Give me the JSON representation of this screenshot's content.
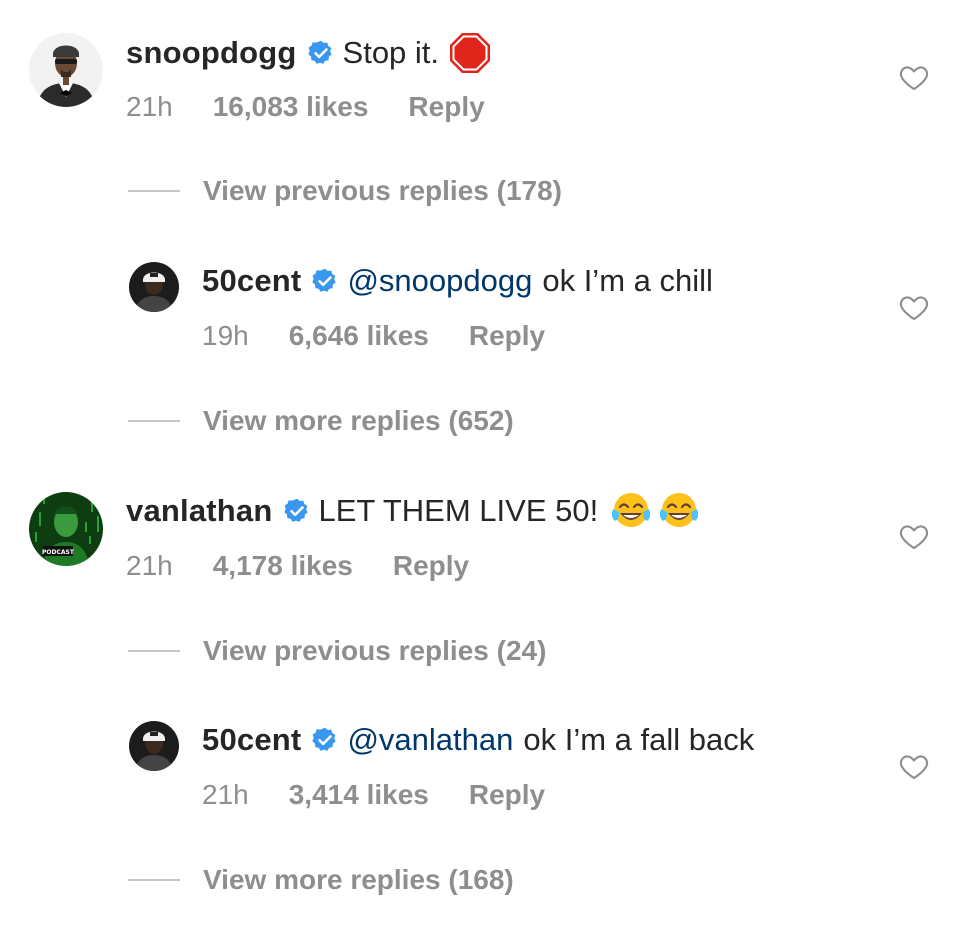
{
  "comments": [
    {
      "username": "snoopdogg",
      "text": "Stop it.",
      "emoji": "stop-sign",
      "time": "21h",
      "likes": "16,083 likes",
      "reply": "Reply"
    },
    {
      "username": "50cent",
      "mention": "@snoopdogg",
      "text": "ok I’m a chill",
      "time": "19h",
      "likes": "6,646 likes",
      "reply": "Reply"
    },
    {
      "username": "vanlathan",
      "text": "LET THEM LIVE 50!",
      "emoji": "face-with-tears-of-joy",
      "time": "21h",
      "likes": "4,178 likes",
      "reply": "Reply"
    },
    {
      "username": "50cent",
      "mention": "@vanlathan",
      "text": "ok I’m a fall back",
      "time": "21h",
      "likes": "3,414 likes",
      "reply": "Reply"
    }
  ],
  "view_links": [
    "View previous replies (178)",
    "View more replies (652)",
    "View previous replies (24)",
    "View more replies (168)"
  ],
  "avatar_labels": {
    "podcast": "PODCAST"
  },
  "icons": {
    "verified": "verified-badge-icon",
    "like": "heart-outline-icon"
  },
  "colors": {
    "text": "#262626",
    "secondary": "#8e8e8e",
    "mention": "#00376b",
    "verified": "#3897f0",
    "stop": "#e0261b"
  }
}
